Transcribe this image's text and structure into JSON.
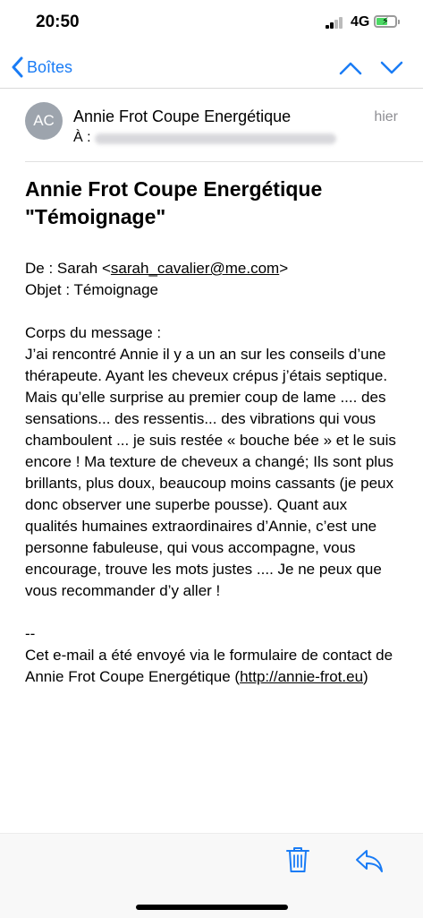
{
  "status_bar": {
    "time": "20:50",
    "network": "4G"
  },
  "nav": {
    "back_label": "Boîtes"
  },
  "header": {
    "avatar_initials": "AC",
    "sender": "Annie Frot Coupe Energétique",
    "date": "hier",
    "to_label": "À :"
  },
  "subject": {
    "line1": "Annie Frot Coupe Energétique",
    "line2": "\"Témoignage\""
  },
  "body": {
    "from_prefix": "De : Sarah <",
    "from_email": "sarah_cavalier@me.com",
    "from_suffix": ">",
    "object": "Objet : Témoignage",
    "corps_label": "Corps du message :",
    "message": "J’ai rencontré Annie il y a un an sur les conseils d’une thérapeute. Ayant les cheveux crépus  j’étais septique. Mais qu’elle surprise au premier coup de lame .... des sensations... des ressentis... des vibrations qui vous chamboulent ... je suis restée « bouche bée » et le suis encore ! Ma texture de cheveux a changé; Ils sont plus brillants, plus doux, beaucoup moins cassants (je peux donc observer une superbe pousse). Quant aux qualités humaines extraordinaires d’Annie, c’est une personne fabuleuse, qui vous accompagne, vous encourage, trouve les mots justes .... Je ne peux que vous recommander d’y aller !",
    "sig_dash": "--",
    "footer_text": "Cet e-mail a été envoyé via le formulaire de contact de Annie Frot Coupe Energétique",
    "footer_link_open": "(",
    "footer_link": "http://annie-frot.eu",
    "footer_link_close": ")"
  },
  "colors": {
    "accent": "#1a7cf5",
    "avatar_bg": "#9da4ad",
    "battery": "#4cd964"
  },
  "icons": [
    "chevron-left-icon",
    "chevron-up-icon",
    "chevron-down-icon",
    "trash-icon",
    "reply-icon"
  ]
}
